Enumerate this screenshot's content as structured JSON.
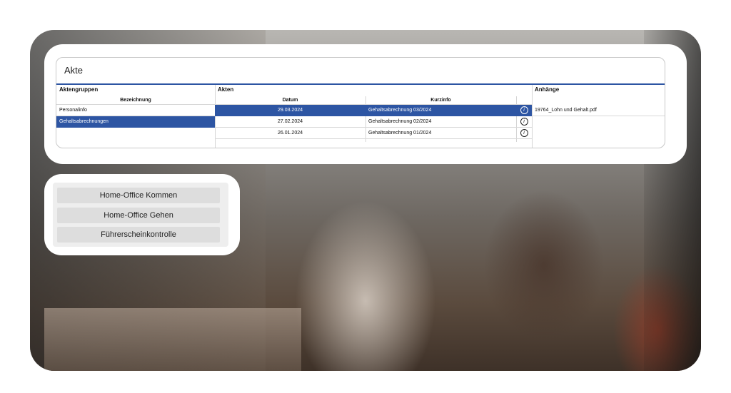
{
  "akte": {
    "title": "Akte",
    "columns": {
      "groups": "Aktengruppen",
      "files": "Akten",
      "attachments": "Anhänge"
    },
    "subheaders": {
      "bezeichnung": "Bezeichnung",
      "datum": "Datum",
      "kurzinfo": "Kurzinfo"
    },
    "groups": [
      {
        "label": "Personalinfo",
        "selected": false
      },
      {
        "label": "Gehaltsabrechnungen",
        "selected": true
      }
    ],
    "files": [
      {
        "datum": "29.03.2024",
        "kurzinfo": "Gehaltsabrechnung 03/2024",
        "selected": true
      },
      {
        "datum": "27.02.2024",
        "kurzinfo": "Gehaltsabrechnung 02/2024",
        "selected": false
      },
      {
        "datum": "26.01.2024",
        "kurzinfo": "Gehaltsabrechnung 01/2024",
        "selected": false
      }
    ],
    "info_glyph": "i",
    "attachments": [
      "19764_Lohn und Gehalt.pdf"
    ]
  },
  "buttons": {
    "home_office_kommen": "Home-Office Kommen",
    "home_office_gehen": "Home-Office Gehen",
    "fuehrerscheinkontrolle": "Führerscheinkontrolle"
  },
  "colors": {
    "accent": "#2d55a3"
  }
}
